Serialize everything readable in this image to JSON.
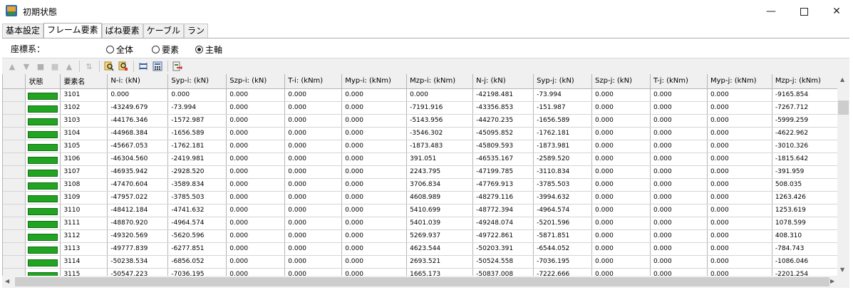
{
  "window": {
    "title": "初期状態",
    "minimize_icon": "minimize-icon",
    "maximize_icon": "maximize-icon",
    "close_icon": "close-icon"
  },
  "tabs": [
    {
      "label": "基本設定",
      "active": false
    },
    {
      "label": "フレーム要素",
      "active": true
    },
    {
      "label": "ばね要素",
      "active": false
    },
    {
      "label": "ケーブル",
      "active": false
    },
    {
      "label": "ラン",
      "active": false
    }
  ],
  "coord": {
    "label": "座標系：",
    "options": [
      {
        "label": "全体",
        "selected": false
      },
      {
        "label": "要素",
        "selected": false
      },
      {
        "label": "主軸",
        "selected": true
      }
    ]
  },
  "toolbar_icons": [
    "move-up-icon",
    "move-down-icon",
    "insert-row-icon",
    "delete-row-icon",
    "sort-icon",
    "sort-az-icon",
    "search-icon",
    "search-edit-icon",
    "swap-icon",
    "calculator-icon",
    "export-icon"
  ],
  "table": {
    "columns": [
      "",
      "状態",
      "要素名",
      "N-i: (kN)",
      "Syp-i: (kN)",
      "Szp-i: (kN)",
      "T-i: (kNm)",
      "Myp-i: (kNm)",
      "Mzp-i: (kNm)",
      "N-j: (kN)",
      "Syp-j: (kN)",
      "Szp-j: (kN)",
      "T-j: (kNm)",
      "Myp-j: (kNm)",
      "Mzp-j: (kNm)"
    ],
    "status_color": "#21a421",
    "rows": [
      [
        "3101",
        "0.000",
        "0.000",
        "0.000",
        "0.000",
        "0.000",
        "0.000",
        "-42198.481",
        "-73.994",
        "0.000",
        "0.000",
        "0.000",
        "-9165.854"
      ],
      [
        "3102",
        "-43249.679",
        "-73.994",
        "0.000",
        "0.000",
        "0.000",
        "-7191.916",
        "-43356.853",
        "-151.987",
        "0.000",
        "0.000",
        "0.000",
        "-7267.712"
      ],
      [
        "3103",
        "-44176.346",
        "-1572.987",
        "0.000",
        "0.000",
        "0.000",
        "-5143.956",
        "-44270.235",
        "-1656.589",
        "0.000",
        "0.000",
        "0.000",
        "-5999.259"
      ],
      [
        "3104",
        "-44968.384",
        "-1656.589",
        "0.000",
        "0.000",
        "0.000",
        "-3546.302",
        "-45095.852",
        "-1762.181",
        "0.000",
        "0.000",
        "0.000",
        "-4622.962"
      ],
      [
        "3105",
        "-45667.053",
        "-1762.181",
        "0.000",
        "0.000",
        "0.000",
        "-1873.483",
        "-45809.593",
        "-1873.981",
        "0.000",
        "0.000",
        "0.000",
        "-3010.326"
      ],
      [
        "3106",
        "-46304.560",
        "-2419.981",
        "0.000",
        "0.000",
        "0.000",
        "391.051",
        "-46535.167",
        "-2589.520",
        "0.000",
        "0.000",
        "0.000",
        "-1815.642"
      ],
      [
        "3107",
        "-46935.942",
        "-2928.520",
        "0.000",
        "0.000",
        "0.000",
        "2243.795",
        "-47199.785",
        "-3110.834",
        "0.000",
        "0.000",
        "0.000",
        "-391.959"
      ],
      [
        "3108",
        "-47470.604",
        "-3589.834",
        "0.000",
        "0.000",
        "0.000",
        "3706.834",
        "-47769.913",
        "-3785.503",
        "0.000",
        "0.000",
        "0.000",
        "508.035"
      ],
      [
        "3109",
        "-47957.022",
        "-3785.503",
        "0.000",
        "0.000",
        "0.000",
        "4608.989",
        "-48279.116",
        "-3994.632",
        "0.000",
        "0.000",
        "0.000",
        "1263.426"
      ],
      [
        "3110",
        "-48412.184",
        "-4741.632",
        "0.000",
        "0.000",
        "0.000",
        "5410.699",
        "-48772.394",
        "-4964.574",
        "0.000",
        "0.000",
        "0.000",
        "1253.619"
      ],
      [
        "3111",
        "-48870.920",
        "-4964.574",
        "0.000",
        "0.000",
        "0.000",
        "5401.039",
        "-49248.074",
        "-5201.596",
        "0.000",
        "0.000",
        "0.000",
        "1078.599"
      ],
      [
        "3112",
        "-49320.569",
        "-5620.596",
        "0.000",
        "0.000",
        "0.000",
        "5269.937",
        "-49722.861",
        "-5871.851",
        "0.000",
        "0.000",
        "0.000",
        "408.310"
      ],
      [
        "3113",
        "-49777.839",
        "-6277.851",
        "0.000",
        "0.000",
        "0.000",
        "4623.544",
        "-50203.391",
        "-6544.052",
        "0.000",
        "0.000",
        "0.000",
        "-784.743"
      ],
      [
        "3114",
        "-50238.534",
        "-6856.052",
        "0.000",
        "0.000",
        "0.000",
        "2693.521",
        "-50524.558",
        "-7036.195",
        "0.000",
        "0.000",
        "0.000",
        "-1086.046"
      ],
      [
        "3115",
        "-50547.223",
        "-7036.195",
        "0.000",
        "0.000",
        "0.000",
        "1665.173",
        "-50837.008",
        "-7222.666",
        "0.000",
        "0.000",
        "0.000",
        "-2201.254"
      ]
    ]
  }
}
